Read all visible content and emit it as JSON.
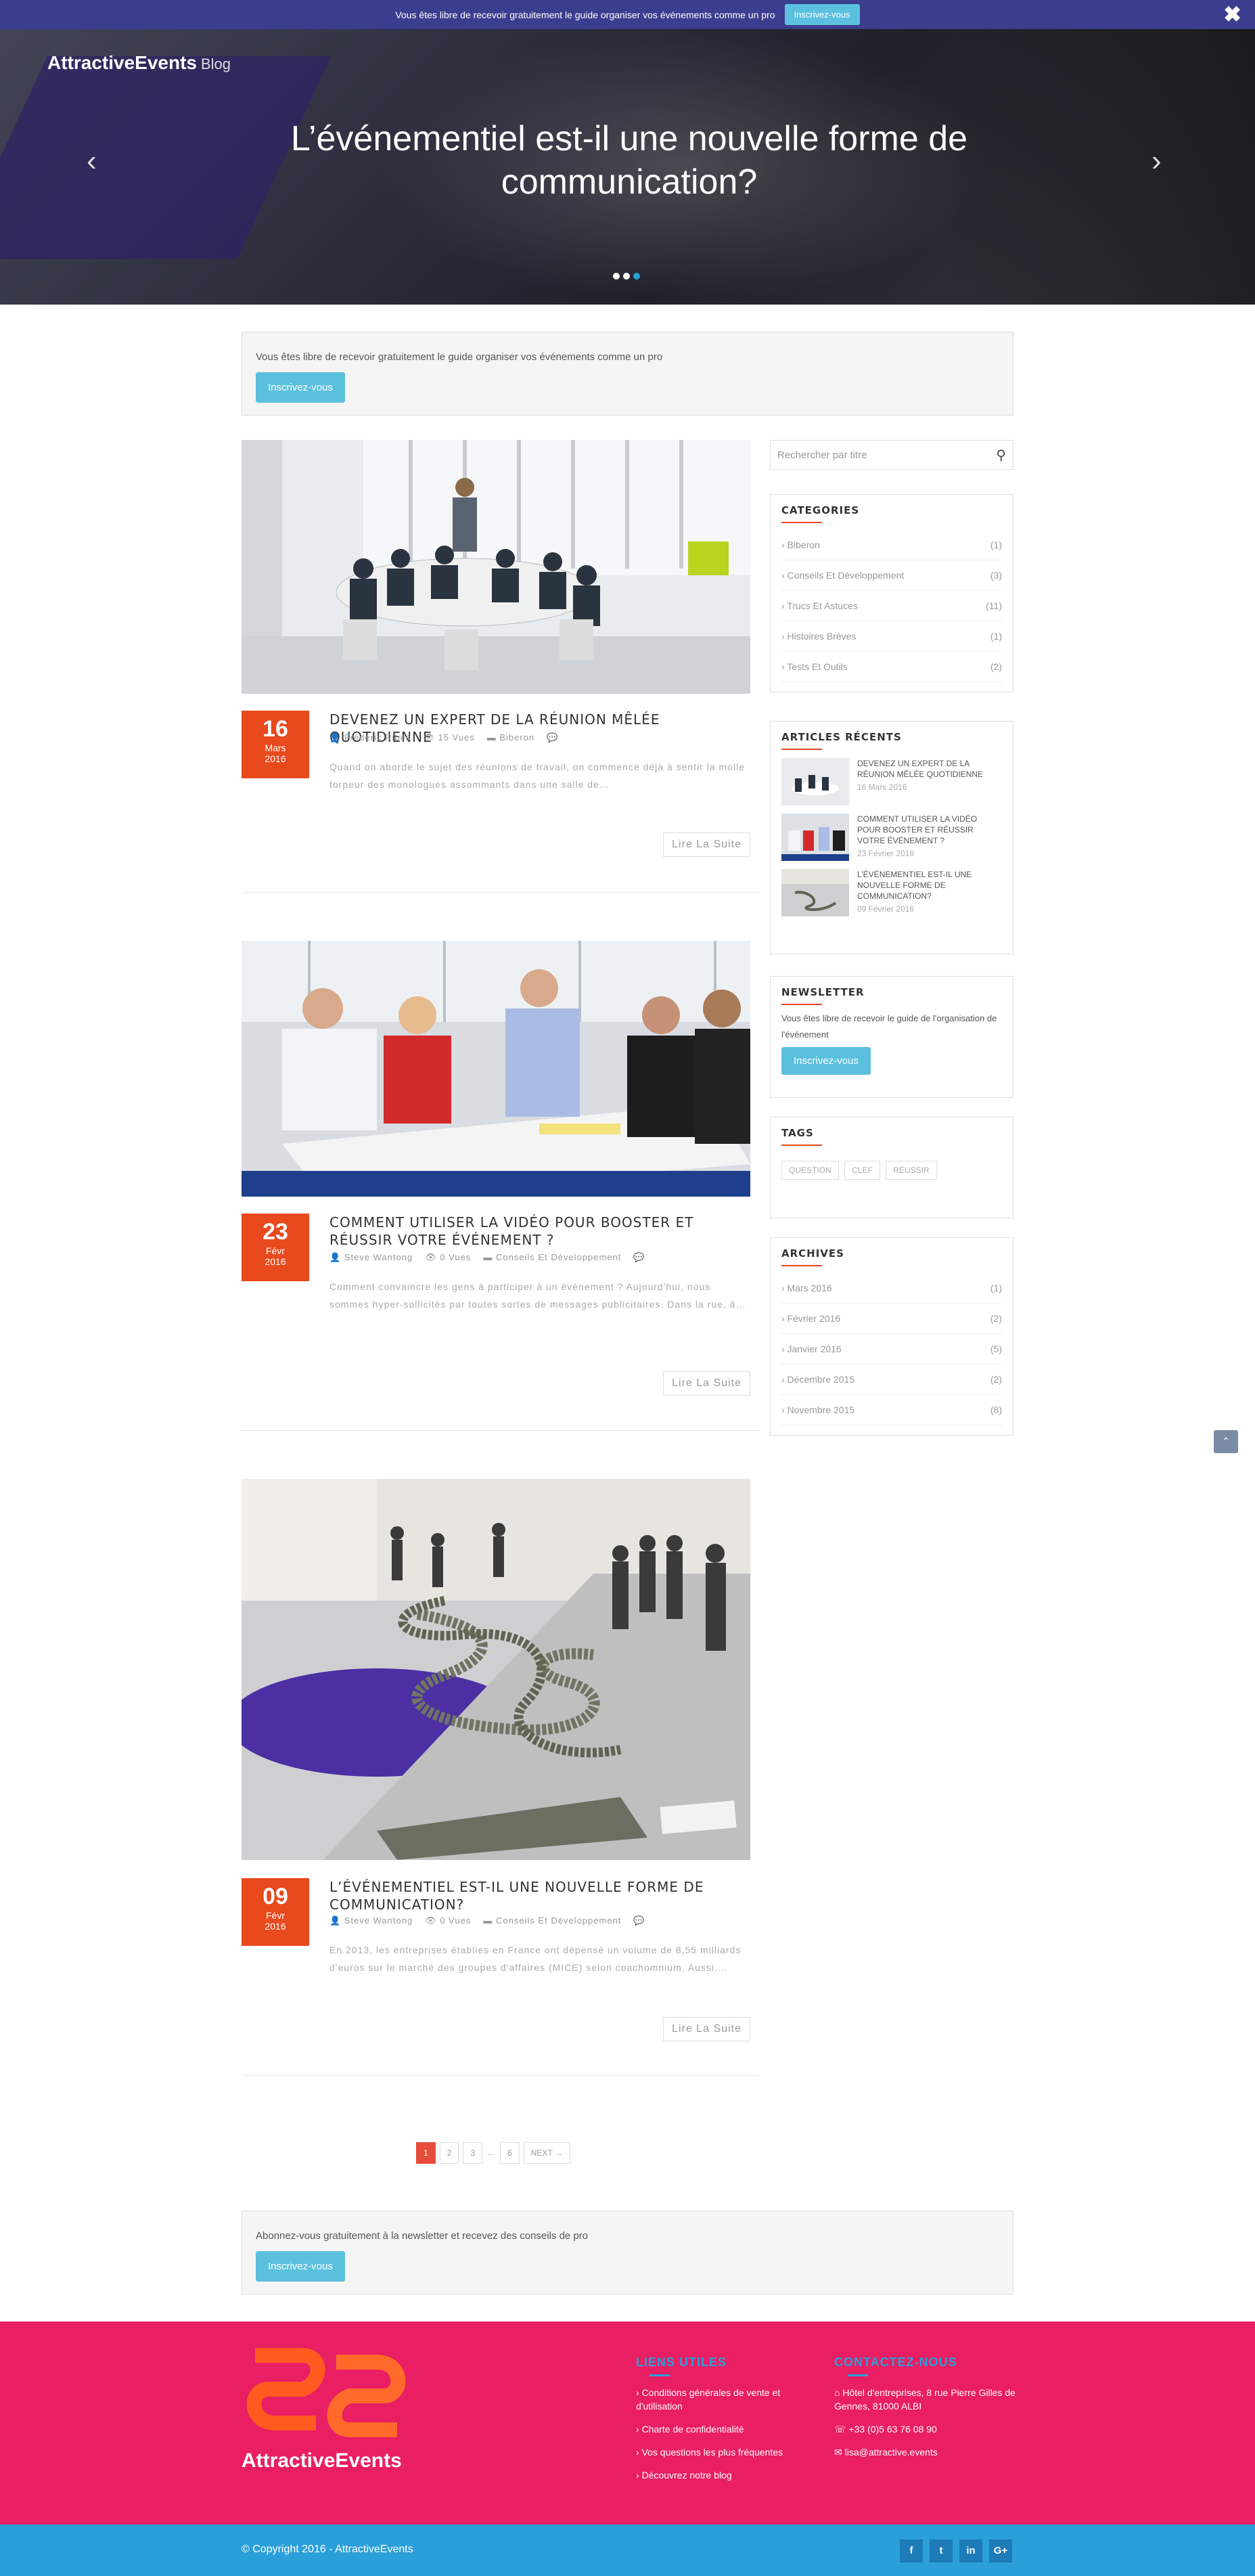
{
  "topbar": {
    "message": "Vous êtes libre de recevoir gratuitement le guide organiser vos événements comme un pro",
    "button": "Inscrivez-vous",
    "close": "✖"
  },
  "header": {
    "brand": "AttractiveEvents",
    "brand_suffix": "Blog"
  },
  "slider": {
    "title": "L’événementiel est-il une nouvelle forme de communication?",
    "prev": "‹",
    "next": "›",
    "active_dot": 3
  },
  "promo_top": {
    "text": "Vous êtes libre de recevoir gratuitement le guide organiser vos événements comme un pro",
    "button": "Inscrivez-vous"
  },
  "posts": [
    {
      "day": "16",
      "month": "Mars",
      "year": "2016",
      "title": "Devenez un expert de la réunion mêlée quotidienne",
      "author": "Frédéric Ribes",
      "views": "15 Vues",
      "category": "Biberon",
      "excerpt": "Quand on aborde le sujet des réunions de travail, on commence déjà à sentir la molle torpeur des monologues assommants dans une salle de…",
      "more": "Lire La Suite"
    },
    {
      "day": "23",
      "month": "Févr",
      "year": "2016",
      "title": "Comment utiliser la vidéo pour booster et réussir votre événement ?",
      "author": "Steve Wantong",
      "views": "0 Vues",
      "category": "Conseils Et Développement",
      "excerpt": "Comment convaincre les gens à participer à un événement ? Aujourd'hui, nous sommes hyper-sollicités par toutes sortes de messages publicitaires. Dans la rue, à…",
      "more": "Lire La Suite"
    },
    {
      "day": "09",
      "month": "Févr",
      "year": "2016",
      "title": "L’événementiel est-il une nouvelle forme de communication?",
      "author": "Steve Wantong",
      "views": "0 Vues",
      "category": "Conseils Et Développement",
      "excerpt": "En 2013, les entreprises établies en France ont dépensé un volume de 8,55 milliards d'euros sur le marché des groupes d'affaires (MICE) selon coachomnium. Aussi,…",
      "more": "Lire La Suite"
    }
  ],
  "sidebar": {
    "search_placeholder": "Rechercher par titre",
    "categories_title": "Categories",
    "categories": [
      {
        "name": "› Biberon",
        "count": "(1)"
      },
      {
        "name": "› Conseils Et Développement",
        "count": "(3)"
      },
      {
        "name": "› Trucs Et Astuces",
        "count": "(11)"
      },
      {
        "name": "› Histoires Brèves",
        "count": "(1)"
      },
      {
        "name": "› Tests Et Outils",
        "count": "(2)"
      }
    ],
    "recent_title": "Articles récents",
    "recent": [
      {
        "title": "Devenez un expert de la réunion mêlée quotidienne",
        "date": "16 Mars 2016"
      },
      {
        "title": "Comment utiliser la vidéo pour booster et réussir votre événement ?",
        "date": "23 Février 2016"
      },
      {
        "title": "L’événementiel est-il une nouvelle forme de communication?",
        "date": "09 Février 2016"
      }
    ],
    "newsletter_title": "Newsletter",
    "newsletter_text": "Vous êtes libre de recevoir le guide de l'organisation de l'événement",
    "newsletter_button": "Inscrivez-vous",
    "tags_title": "Tags",
    "tags": [
      "question",
      "clef",
      "réussir"
    ],
    "archives_title": "Archives",
    "archives": [
      {
        "name": "› Mars 2016",
        "count": "(1)"
      },
      {
        "name": "› Février 2016",
        "count": "(2)"
      },
      {
        "name": "› Janvier 2016",
        "count": "(5)"
      },
      {
        "name": "› Décembre 2015",
        "count": "(2)"
      },
      {
        "name": "› Novembre 2015",
        "count": "(8)"
      }
    ]
  },
  "pagination": {
    "pages": [
      "1",
      "2",
      "3"
    ],
    "ellipsis": "...",
    "last": "6",
    "next": "NEXT →"
  },
  "promo_bottom": {
    "text": "Abonnez-vous gratuitement à la newsletter et recevez des conseils de pro",
    "button": "Inscrivez-vous"
  },
  "footer": {
    "brand": "AttractiveEvents",
    "links_title": "Liens utiles",
    "links": [
      "Conditions générales de vente et d'utilisation",
      "Charte de confidentialité",
      "Vos questions les plus fréquentes",
      "Découvrez notre blog"
    ],
    "contact_title": "Contactez-nous",
    "address": "Hôtel d'entreprises, 8 rue Pierre Gilles de Gennes, 81000 ALBI",
    "phone": "+33 (0)5 63 76 08 90",
    "email": "lisa@attractive.events",
    "copyright": "© Copyright 2016 - AttractiveEvents",
    "social": [
      "f",
      "t",
      "in",
      "G+"
    ]
  },
  "colors": {
    "accent": "#e8491d",
    "blue": "#5bc0de",
    "footer_pink": "#e91e63",
    "footer_blue": "#2b9fd9",
    "topbar": "#3d3d8f"
  }
}
